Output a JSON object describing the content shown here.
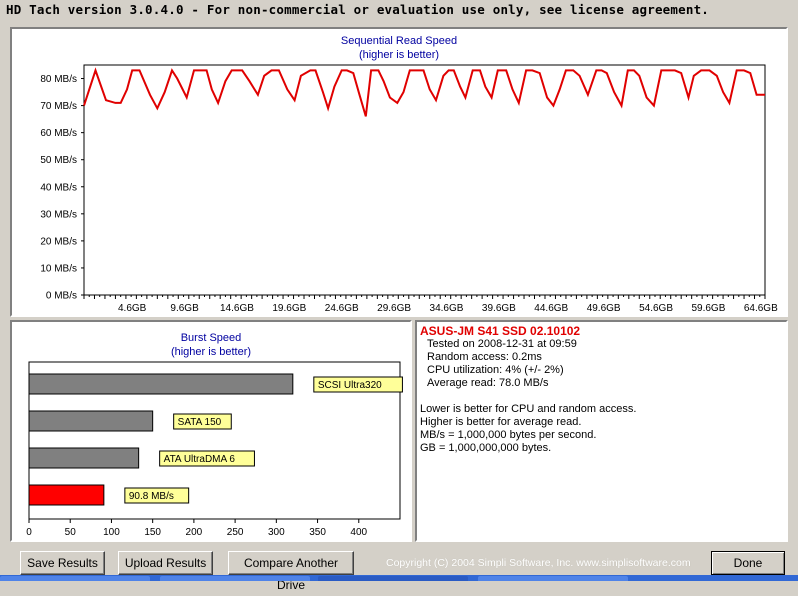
{
  "window": {
    "title": "HD Tach version 3.0.4.0  - For non-commercial or evaluation use only, see license agreement."
  },
  "sequential": {
    "title": "Sequential Read Speed",
    "subtitle": "(higher is better)"
  },
  "burst": {
    "title": "Burst Speed",
    "subtitle": "(higher is better)"
  },
  "chart_data": [
    {
      "type": "line",
      "title": "Sequential Read Speed",
      "subtitle": "(higher is better)",
      "ylabel": "",
      "xlabel": "",
      "y_tick_labels": [
        "0 MB/s",
        "10 MB/s",
        "20 MB/s",
        "30 MB/s",
        "40 MB/s",
        "50 MB/s",
        "60 MB/s",
        "70 MB/s",
        "80 MB/s"
      ],
      "x_tick_labels": [
        "4.6GB",
        "9.6GB",
        "14.6GB",
        "19.6GB",
        "24.6GB",
        "29.6GB",
        "34.6GB",
        "39.6GB",
        "44.6GB",
        "49.6GB",
        "54.6GB",
        "59.6GB",
        "64.6GB"
      ],
      "ylim": [
        0,
        85
      ],
      "xlim": [
        0,
        65
      ],
      "series": [
        {
          "color": "#e00000",
          "x": [
            0,
            1.1,
            2.1,
            3.0,
            3.5,
            4.1,
            4.6,
            5.3,
            6.3,
            7.0,
            7.7,
            8.4,
            8.9,
            9.8,
            10.5,
            11.1,
            11.7,
            12.2,
            12.8,
            13.5,
            14.1,
            14.6,
            15.1,
            15.8,
            16.6,
            17.2,
            17.9,
            18.6,
            19.4,
            20.1,
            20.7,
            21.6,
            22.1,
            22.8,
            23.3,
            23.9,
            24.6,
            25.1,
            25.7,
            26.3,
            26.9,
            27.4,
            28.1,
            28.6,
            29.2,
            29.9,
            30.5,
            31.1,
            32.0,
            32.4,
            33.0,
            33.6,
            34.3,
            34.8,
            35.3,
            35.9,
            36.4,
            37.1,
            37.8,
            38.3,
            38.9,
            39.5,
            40.3,
            40.9,
            41.5,
            42.2,
            42.8,
            43.5,
            44.2,
            44.8,
            45.4,
            46.0,
            46.7,
            47.3,
            48.1,
            48.9,
            49.4,
            49.9,
            50.6,
            51.3,
            51.9,
            52.5,
            53.0,
            53.7,
            54.4,
            55.1,
            55.6,
            56.4,
            57.0,
            57.7,
            58.2,
            58.9,
            59.7,
            60.4,
            61.0,
            61.6,
            62.3,
            63.0,
            63.6,
            64.2,
            65.0
          ],
          "values": [
            70,
            83,
            72,
            71,
            71,
            76,
            83,
            83,
            74,
            69,
            75,
            83,
            80,
            73,
            83,
            83,
            83,
            76,
            71,
            79,
            83,
            83,
            83,
            79,
            74,
            81,
            83,
            83,
            76,
            72,
            81,
            83,
            83,
            75,
            69,
            77,
            83,
            83,
            82,
            74,
            66,
            83,
            83,
            79,
            73,
            71,
            75,
            83,
            83,
            83,
            76,
            72,
            81,
            83,
            83,
            77,
            73,
            83,
            83,
            77,
            73,
            83,
            83,
            76,
            71,
            83,
            83,
            82,
            73,
            70,
            76,
            83,
            83,
            81,
            74,
            83,
            83,
            82,
            75,
            70,
            83,
            83,
            81,
            73,
            70,
            83,
            83,
            83,
            82,
            73,
            81,
            83,
            83,
            81,
            75,
            71,
            83,
            83,
            82,
            74,
            74
          ]
        }
      ]
    },
    {
      "type": "bar",
      "title": "Burst Speed",
      "subtitle": "(higher is better)",
      "orientation": "horizontal",
      "xlim": [
        0,
        450
      ],
      "x_tick_labels": [
        "0",
        "50",
        "100",
        "150",
        "200",
        "250",
        "300",
        "350",
        "400"
      ],
      "categories": [
        "SCSI Ultra320",
        "SATA 150",
        "ATA UltraDMA 6",
        "90.8 MB/s"
      ],
      "values": [
        320,
        150,
        133,
        90.8
      ],
      "colors": [
        "#808080",
        "#808080",
        "#808080",
        "#ff0000"
      ]
    }
  ],
  "info": {
    "drive": "ASUS-JM S41 SSD 02.10102",
    "tested": "Tested on 2008-12-31 at 09:59",
    "random_access": "Random access: 0.2ms",
    "cpu": "CPU utilization: 4% (+/- 2%)",
    "average_read": "Average read: 78.0 MB/s",
    "note1": "Lower is better for CPU and random access.",
    "note2": "Higher is better for average read.",
    "note3": "MB/s = 1,000,000 bytes per second.",
    "note4": "GB = 1,000,000,000 bytes."
  },
  "buttons": {
    "save": "Save Results",
    "upload": "Upload Results",
    "compare": "Compare Another Drive",
    "done": "Done"
  },
  "copyright": "Copyright (C) 2004 Simpli Software, Inc. www.simplisoftware.com",
  "colors": {
    "background": "#d4d0c8",
    "series": "#e00000",
    "label_bg": "#ffff99",
    "title_text": "#0000a0"
  }
}
